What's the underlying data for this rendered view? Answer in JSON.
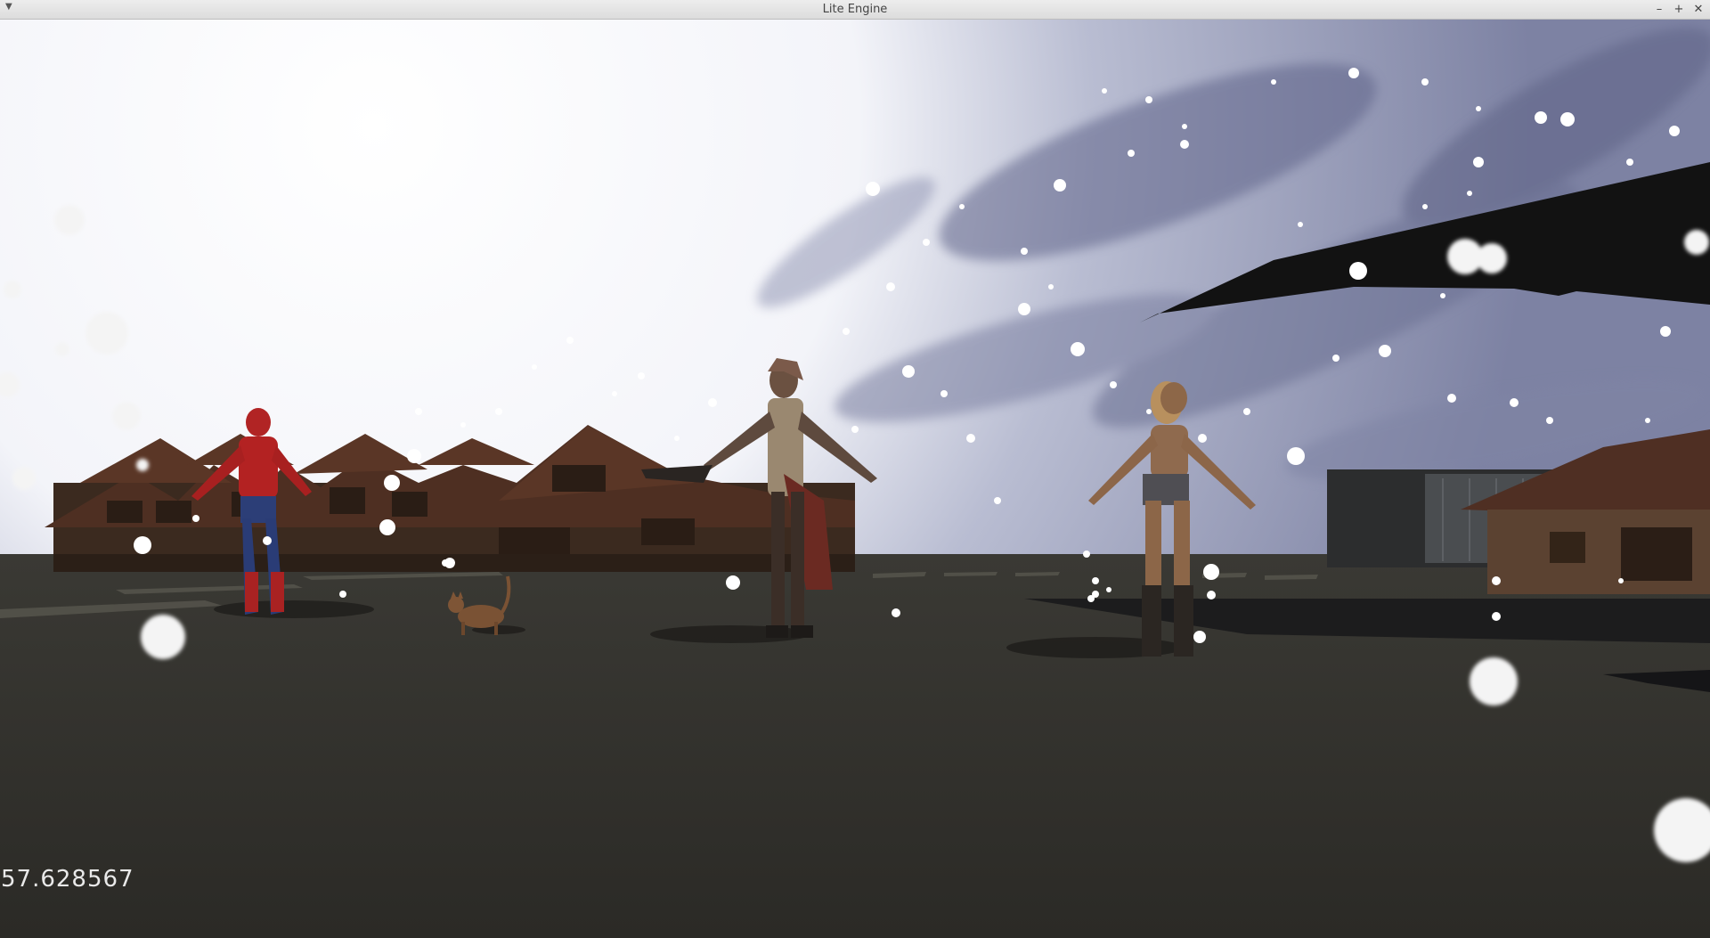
{
  "window": {
    "title": "Lite Engine",
    "menu_icon": "chevron-down-icon",
    "controls": {
      "minimize": "–",
      "maximize": "+",
      "close": "✕"
    }
  },
  "hud": {
    "fps_value": "57.628567"
  },
  "scene": {
    "sky_colors": {
      "bright": "#ffffff",
      "haze": "#c9cde0",
      "nebula": "#6c7196"
    },
    "ground_color": "#2e2d28",
    "building_color": "#3e2b20",
    "roof_color": "#5a3626"
  }
}
